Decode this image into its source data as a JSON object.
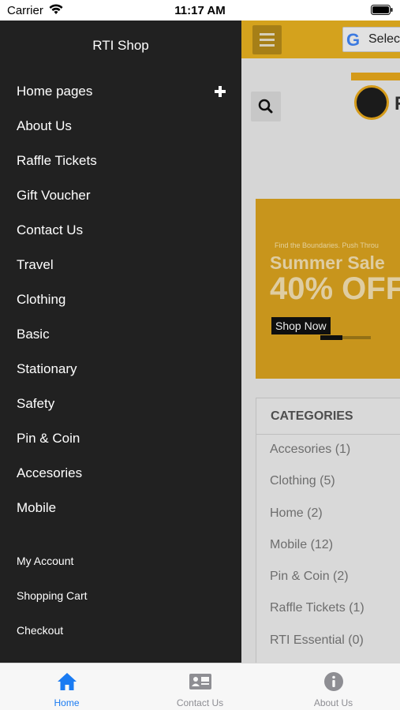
{
  "status_bar": {
    "carrier": "Carrier",
    "time": "11:17 AM"
  },
  "drawer": {
    "title": "RTI Shop",
    "menu": [
      {
        "label": "Home pages",
        "expandable": true
      },
      {
        "label": "About Us"
      },
      {
        "label": "Raffle Tickets"
      },
      {
        "label": "Gift Voucher"
      },
      {
        "label": "Contact Us"
      },
      {
        "label": "Travel"
      },
      {
        "label": "Clothing"
      },
      {
        "label": "Basic"
      },
      {
        "label": "Stationary"
      },
      {
        "label": "Safety"
      },
      {
        "label": "Pin & Coin"
      },
      {
        "label": "Accesories"
      },
      {
        "label": "Mobile"
      }
    ],
    "account_links": [
      {
        "label": "My Account"
      },
      {
        "label": "Shopping Cart"
      },
      {
        "label": "Checkout"
      }
    ]
  },
  "main": {
    "translate_label": "Selec",
    "logo_letter": "R",
    "banner": {
      "tagline": "Find the Boundaries. Push Throu",
      "headline": "Summer Sale",
      "discount": "40% OFF",
      "button": "Shop Now"
    },
    "categories": {
      "header": "CATEGORIES",
      "items": [
        "Accesories (1)",
        "Clothing (5)",
        "Home (2)",
        "Mobile (12)",
        "Pin & Coin (2)",
        "Raffle Tickets (1)",
        "RTI Essential (0)"
      ]
    }
  },
  "tab_bar": {
    "tabs": [
      {
        "label": "Home",
        "icon": "home-icon",
        "active": true
      },
      {
        "label": "Contact Us",
        "icon": "contact-card-icon",
        "active": false
      },
      {
        "label": "About Us",
        "icon": "info-icon",
        "active": false
      }
    ]
  },
  "colors": {
    "accent": "#e6b020",
    "drawer_bg": "#212121",
    "active_tab": "#1a7bf2"
  }
}
